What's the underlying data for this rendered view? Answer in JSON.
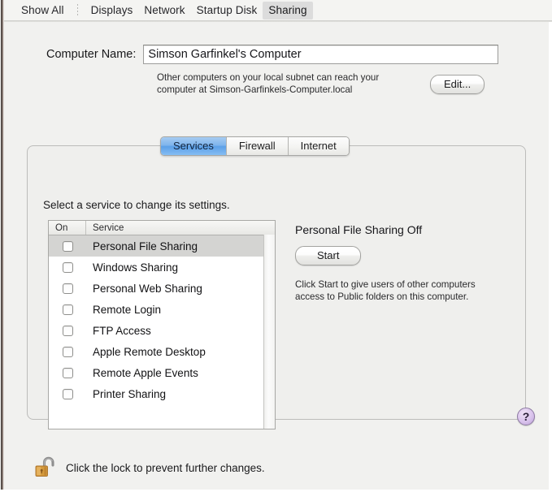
{
  "toolbar": {
    "show_all": "Show All",
    "items": [
      {
        "label": "Displays"
      },
      {
        "label": "Network"
      },
      {
        "label": "Startup Disk"
      },
      {
        "label": "Sharing"
      }
    ],
    "selected": "Sharing"
  },
  "computer_name": {
    "label": "Computer Name:",
    "value": "Simson Garfinkel's Computer",
    "placeholder": "Computer Name"
  },
  "subnet": {
    "text": "Other computers on your local subnet can reach your\ncomputer at Simson-Garfinkels-Computer.local",
    "edit_label": "Edit..."
  },
  "tabs": [
    {
      "label": "Services",
      "selected": true
    },
    {
      "label": "Firewall",
      "selected": false
    },
    {
      "label": "Internet",
      "selected": false
    }
  ],
  "instruction": "Select a service to change its settings.",
  "services_table": {
    "columns": [
      "On",
      "Service"
    ],
    "rows": [
      {
        "name": "Personal File Sharing",
        "on": false,
        "selected": true
      },
      {
        "name": "Windows Sharing",
        "on": false,
        "selected": false
      },
      {
        "name": "Personal Web Sharing",
        "on": false,
        "selected": false
      },
      {
        "name": "Remote Login",
        "on": false,
        "selected": false
      },
      {
        "name": "FTP Access",
        "on": false,
        "selected": false
      },
      {
        "name": "Apple Remote Desktop",
        "on": false,
        "selected": false
      },
      {
        "name": "Remote Apple Events",
        "on": false,
        "selected": false
      },
      {
        "name": "Printer Sharing",
        "on": false,
        "selected": false
      }
    ]
  },
  "detail": {
    "title": "Personal File Sharing Off",
    "start_label": "Start",
    "description": "Click Start to give users of other computers\naccess to Public folders on this computer."
  },
  "help": {
    "glyph": "?",
    "icon": "question-mark-icon"
  },
  "lock": {
    "text": "Click the lock to prevent further changes.",
    "icon": "unlocked-padlock-icon",
    "state": "unlocked"
  },
  "colors": {
    "selected_tab_blue": "#5ba0e8",
    "window_bg": "#f1f1ef",
    "row_selected": "#d4d4d2",
    "help_purple": "#bda2d8",
    "lock_gold": "#d59a3c"
  }
}
